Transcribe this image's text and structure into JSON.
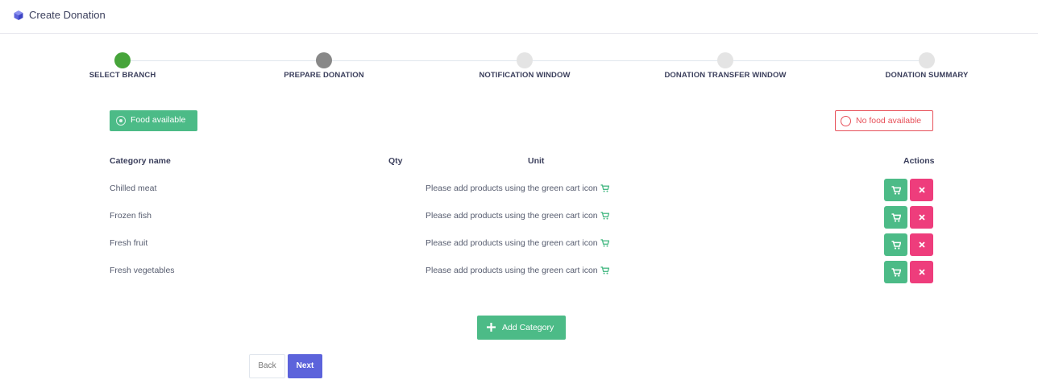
{
  "header": {
    "title": "Create Donation",
    "icon": "cube-icon"
  },
  "stepper": {
    "steps": [
      {
        "label": "SELECT BRANCH",
        "state": "done"
      },
      {
        "label": "PREPARE DONATION",
        "state": "current"
      },
      {
        "label": "NOTIFICATION WINDOW",
        "state": "pending"
      },
      {
        "label": "DONATION TRANSFER WINDOW",
        "state": "pending"
      },
      {
        "label": "DONATION SUMMARY",
        "state": "pending"
      }
    ]
  },
  "availability": {
    "food_label": "Food available",
    "nofood_label": "No food available",
    "selected": "Food available"
  },
  "table": {
    "headers": {
      "category": "Category name",
      "qty": "Qty",
      "unit": "Unit",
      "actions": "Actions"
    },
    "rows": [
      {
        "category": "Chilled meat",
        "hint": "Please add products using the green cart icon"
      },
      {
        "category": "Frozen fish",
        "hint": "Please add products using the green cart icon"
      },
      {
        "category": "Fresh fruit",
        "hint": "Please add products using the green cart icon"
      },
      {
        "category": "Fresh vegetables",
        "hint": "Please add products using the green cart icon"
      }
    ]
  },
  "buttons": {
    "add_category": "Add Category",
    "back": "Back",
    "next": "Next"
  },
  "colors": {
    "green": "#4cbb87",
    "pink": "#ee3d7c",
    "red": "#e7515a",
    "primary": "#5c63db",
    "step_done": "#46a43a",
    "step_current": "#888888",
    "step_pending": "#e4e4e4"
  }
}
